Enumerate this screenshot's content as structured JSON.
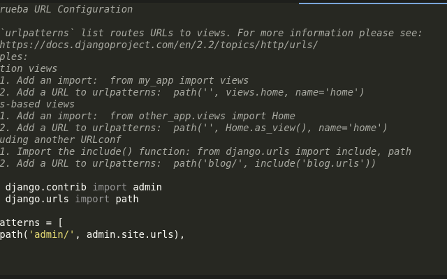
{
  "editor": {
    "language": "python",
    "theme_colors": {
      "background": "#272822",
      "comment": "#a9aaa2",
      "text": "#f8f8f2",
      "string": "#e6db74",
      "keyword_from": "#f92672",
      "keyword_import": "#949494",
      "tab_highlight": "#7aa6da"
    },
    "lines": [
      {
        "text": "prueba URL Configuration",
        "kind": "comment"
      },
      {
        "text": "",
        "kind": "blank"
      },
      {
        "text": " `urlpatterns` list routes URLs to views. For more information please see:",
        "kind": "comment"
      },
      {
        "text": " https://docs.djangoproject.com/en/2.2/topics/http/urls/",
        "kind": "comment"
      },
      {
        "text": "mples:",
        "kind": "comment"
      },
      {
        "text": "ction views",
        "kind": "comment"
      },
      {
        "text": " 1. Add an import:  from my_app import views",
        "kind": "comment"
      },
      {
        "text": " 2. Add a URL to urlpatterns:  path('', views.home, name='home')",
        "kind": "comment"
      },
      {
        "text": "ss-based views",
        "kind": "comment"
      },
      {
        "text": " 1. Add an import:  from other_app.views import Home",
        "kind": "comment"
      },
      {
        "text": " 2. Add a URL to urlpatterns:  path('', Home.as_view(), name='home')",
        "kind": "comment"
      },
      {
        "text": "luding another URLconf",
        "kind": "comment"
      },
      {
        "text": " 1. Import the include() function: from django.urls import include, path",
        "kind": "comment"
      },
      {
        "text": " 2. Add a URL to urlpatterns:  path('blog/', include('blog.urls'))",
        "kind": "comment"
      },
      {
        "text": "",
        "kind": "blank"
      },
      {
        "text": "m django.contrib import admin",
        "kind": "import1"
      },
      {
        "text": "m django.urls import path",
        "kind": "import2"
      },
      {
        "text": "",
        "kind": "blank"
      },
      {
        "text": "patterns = [",
        "kind": "plain"
      },
      {
        "text": "path('admin/', admin.site.urls),",
        "kind": "pathcall"
      }
    ],
    "tokens": {
      "import1": {
        "from_kw": "m",
        "module": " django.contrib ",
        "import_kw": "import",
        "name": " admin"
      },
      "import2": {
        "from_kw": "m",
        "module": " django.urls ",
        "import_kw": "import",
        "name": " path"
      },
      "pathcall": {
        "indent": " ",
        "fn": "path(",
        "arg": "'admin/'",
        "rest": ", admin.site.urls),"
      }
    }
  }
}
